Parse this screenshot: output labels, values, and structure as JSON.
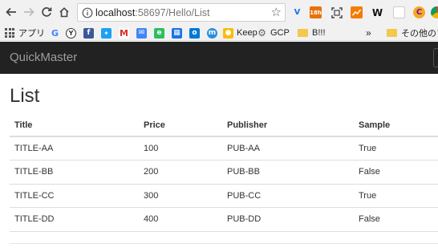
{
  "browser": {
    "url_host": "localhost",
    "url_rest": ":58697/Hello/List",
    "extensions": [
      {
        "name": "v-extension",
        "letter": "V",
        "color": "#1a73e8"
      },
      {
        "name": "calendar-extension",
        "letter": "18h",
        "color": "#e8710a"
      },
      {
        "name": "capture-extension",
        "letter": "",
        "color": "#444444"
      },
      {
        "name": "chart-extension",
        "letter": "",
        "color": "#f57c00"
      },
      {
        "name": "word-extension",
        "letter": "W",
        "color": "#ffffff"
      },
      {
        "name": "blank-extension",
        "letter": "",
        "color": "#dddddd"
      },
      {
        "name": "c-extension",
        "letter": "C",
        "color": "#f9a825"
      },
      {
        "name": "chrome-extension",
        "letter": "",
        "color": "#db4437"
      }
    ],
    "bookmarks": {
      "apps": "アプリ",
      "keep": "Keep",
      "gcp": "GCP",
      "b3": "B!!!",
      "more": "»",
      "other": "その他のブッ"
    }
  },
  "app": {
    "brand": "QuickMaster"
  },
  "page": {
    "heading": "List",
    "columns": {
      "title": "Title",
      "price": "Price",
      "publisher": "Publisher",
      "sample": "Sample"
    },
    "rows": [
      {
        "title": "TITLE-AA",
        "price": "100",
        "publisher": "PUB-AA",
        "sample": "True"
      },
      {
        "title": "TITLE-BB",
        "price": "200",
        "publisher": "PUB-BB",
        "sample": "False"
      },
      {
        "title": "TITLE-CC",
        "price": "300",
        "publisher": "PUB-CC",
        "sample": "True"
      },
      {
        "title": "TITLE-DD",
        "price": "400",
        "publisher": "PUB-DD",
        "sample": "False"
      }
    ]
  }
}
